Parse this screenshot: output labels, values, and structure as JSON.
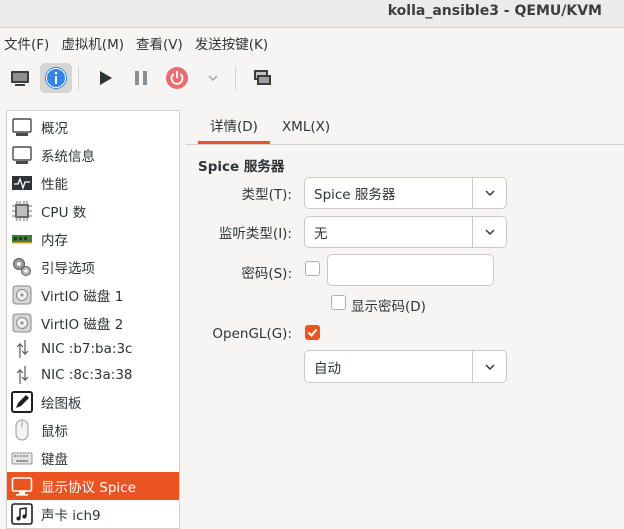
{
  "window": {
    "title": "kolla_ansible3 - QEMU/KVM"
  },
  "menubar": {
    "items": [
      "文件(F)",
      "虚拟机(M)",
      "查看(V)",
      "发送按键(K)"
    ]
  },
  "toolbar": {
    "buttons": [
      "monitor-icon",
      "info-icon",
      "play-icon",
      "pause-icon",
      "power-icon",
      "chevron-down-icon",
      "snapshot-icon"
    ]
  },
  "sidebar": {
    "items": [
      {
        "label": "概况",
        "icon": "monitor-icon"
      },
      {
        "label": "系统信息",
        "icon": "monitor-icon"
      },
      {
        "label": "性能",
        "icon": "performance-icon"
      },
      {
        "label": "CPU 数",
        "icon": "cpu-icon"
      },
      {
        "label": "内存",
        "icon": "memory-icon"
      },
      {
        "label": "引导选项",
        "icon": "boot-gears-icon"
      },
      {
        "label": "VirtIO 磁盘 1",
        "icon": "disk-icon"
      },
      {
        "label": "VirtIO 磁盘 2",
        "icon": "disk-icon"
      },
      {
        "label": "NIC :b7:ba:3c",
        "icon": "network-icon"
      },
      {
        "label": "NIC :8c:3a:38",
        "icon": "network-icon"
      },
      {
        "label": "绘图板",
        "icon": "tablet-icon"
      },
      {
        "label": "鼠标",
        "icon": "mouse-icon"
      },
      {
        "label": "键盘",
        "icon": "keyboard-icon"
      },
      {
        "label": "显示协议 Spice",
        "icon": "display-icon",
        "selected": true
      },
      {
        "label": "声卡 ich9",
        "icon": "sound-icon"
      }
    ]
  },
  "tabs": [
    {
      "label": "详情(D)",
      "active": true
    },
    {
      "label": "XML(X)",
      "active": false
    }
  ],
  "details": {
    "section_title": "Spice 服务器",
    "type_label": "类型(T):",
    "type_value": "Spice 服务器",
    "listen_label": "监听类型(I):",
    "listen_value": "无",
    "password_label": "密码(S):",
    "password_value": "",
    "password_enabled": false,
    "show_password_label": "显示密码(D)",
    "show_password_checked": false,
    "opengl_label": "OpenGL(G):",
    "opengl_checked": true,
    "opengl_value": "自动"
  },
  "colors": {
    "accent": "#e95420",
    "info_blue": "#3584e4",
    "power_red": "#e66d72"
  }
}
